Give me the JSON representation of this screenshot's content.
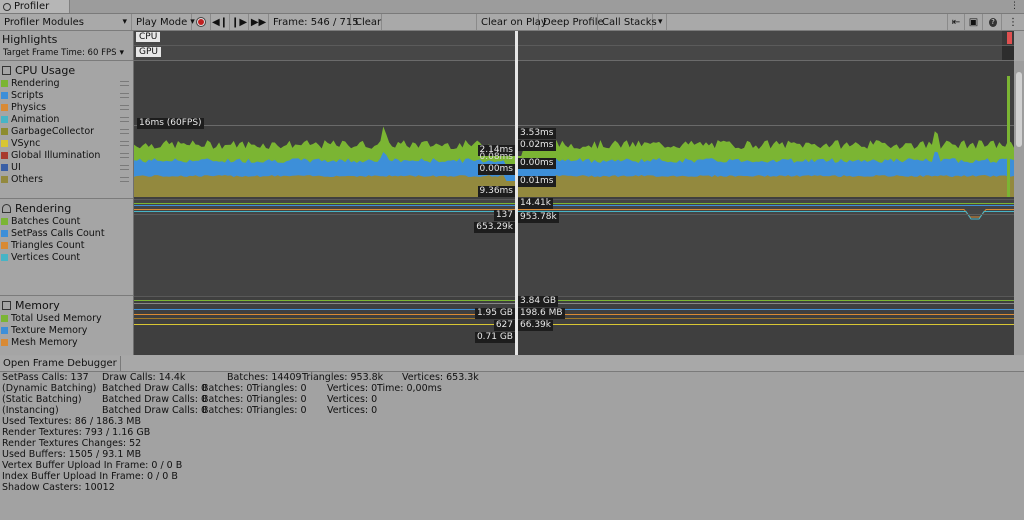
{
  "window": {
    "tab_title": "Profiler",
    "menu_icon": "kebab-menu-icon"
  },
  "toolbar": {
    "modules_label": "Profiler Modules",
    "play_mode_label": "Play Mode",
    "frame_label": "Frame: 546 / 715",
    "clear_label": "Clear",
    "clear_on_play_label": "Clear on Play",
    "deep_profile_label": "Deep Profile",
    "call_stacks_label": "Call Stacks",
    "icons": [
      "record-icon",
      "step-back-icon",
      "step-forward-icon",
      "last-frame-icon",
      "load-icon",
      "save-icon",
      "help-icon",
      "kebab-menu-icon"
    ]
  },
  "highlights": {
    "title": "Highlights",
    "target_frame_time": "Target Frame Time: 60 FPS",
    "cpu_label": "CPU",
    "gpu_label": "GPU"
  },
  "cpu": {
    "title": "CPU Usage",
    "icon_label": "CPU",
    "legend": [
      {
        "label": "Rendering",
        "color": "#7bb533"
      },
      {
        "label": "Scripts",
        "color": "#3d8fd9"
      },
      {
        "label": "Physics",
        "color": "#d98a34"
      },
      {
        "label": "Animation",
        "color": "#47b4c6"
      },
      {
        "label": "GarbageCollector",
        "color": "#8d8c2f"
      },
      {
        "label": "VSync",
        "color": "#d8c633"
      },
      {
        "label": "Global Illumination",
        "color": "#a83a2d"
      },
      {
        "label": "UI",
        "color": "#3a5fa5"
      },
      {
        "label": "Others",
        "color": "#93893e"
      }
    ],
    "threshold_label": "16ms (60FPS)",
    "readouts_left": [
      "2.14ms",
      "0.08ms",
      "0.00ms",
      "9.36ms"
    ],
    "readouts_right": [
      "3.53ms",
      "0.02ms",
      "0.00ms",
      "0.01ms"
    ]
  },
  "rendering": {
    "title": "Rendering",
    "legend": [
      {
        "label": "Batches Count",
        "color": "#7bb533"
      },
      {
        "label": "SetPass Calls Count",
        "color": "#3d8fd9"
      },
      {
        "label": "Triangles Count",
        "color": "#d98a34"
      },
      {
        "label": "Vertices Count",
        "color": "#47b4c6"
      }
    ],
    "readouts_left": [
      "137",
      "653.29k"
    ],
    "readouts_right": [
      "14.41k",
      "953.78k"
    ]
  },
  "memory": {
    "title": "Memory",
    "legend": [
      {
        "label": "Total Used Memory",
        "color": "#7bb533"
      },
      {
        "label": "Texture Memory",
        "color": "#3d8fd9"
      },
      {
        "label": "Mesh Memory",
        "color": "#d98a34"
      }
    ],
    "readouts_left": [
      "1.95 GB",
      "627",
      "0.71 GB"
    ],
    "readouts_right": [
      "3.84 GB",
      "198.6 MB",
      "66.39k"
    ]
  },
  "details": {
    "open_frame_debugger": "Open Frame Debugger",
    "rows": [
      [
        "SetPass Calls: 137",
        "Draw Calls: 14.4k",
        "Batches: 14409",
        "Triangles: 953.8k",
        "Vertices: 653.3k"
      ],
      [
        "(Dynamic Batching)",
        "Batched Draw Calls: 0",
        "Batches: 0",
        "Triangles: 0",
        "Vertices: 0",
        "Time: 0,00ms"
      ],
      [
        "(Static Batching)",
        "Batched Draw Calls: 0",
        "Batches: 0",
        "Triangles: 0",
        "Vertices: 0"
      ],
      [
        "(Instancing)",
        "Batched Draw Calls: 0",
        "Batches: 0",
        "Triangles: 0",
        "Vertices: 0"
      ]
    ],
    "lines": [
      "Used Textures: 86 / 186.3 MB",
      "Render Textures: 793 / 1.16 GB",
      "Render Textures Changes: 52",
      "Used Buffers: 1505 / 93.1 MB",
      "Vertex Buffer Upload In Frame: 0 / 0 B",
      "Index Buffer Upload In Frame: 0 / 0 B",
      "Shadow Casters: 10012"
    ]
  }
}
